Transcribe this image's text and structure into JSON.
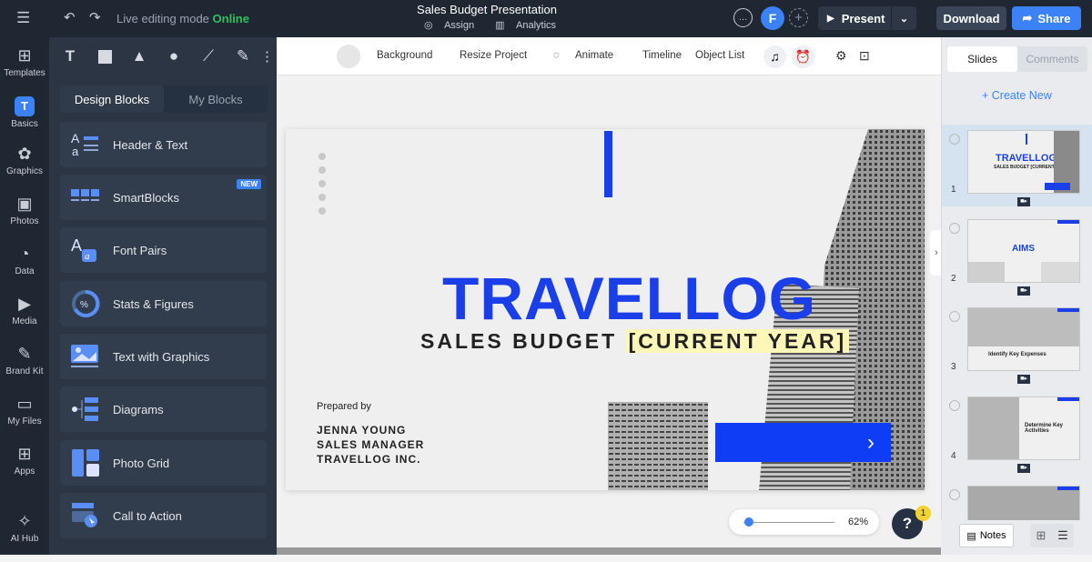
{
  "topbar": {
    "mode_label": "Live editing mode",
    "mode_status": "Online",
    "title": "Sales Budget Presentation",
    "assign_label": "Assign",
    "analytics_label": "Analytics",
    "avatar_letter": "F",
    "present_label": "Present",
    "download_label": "Download",
    "share_label": "Share"
  },
  "rail": {
    "items": [
      {
        "label": "Templates",
        "icon": "templates-icon"
      },
      {
        "label": "Basics",
        "icon": "basics-icon"
      },
      {
        "label": "Graphics",
        "icon": "graphics-icon"
      },
      {
        "label": "Photos",
        "icon": "photos-icon"
      },
      {
        "label": "Data",
        "icon": "data-icon"
      },
      {
        "label": "Media",
        "icon": "media-icon"
      },
      {
        "label": "Brand Kit",
        "icon": "brand-kit-icon"
      },
      {
        "label": "My Files",
        "icon": "folder-icon"
      },
      {
        "label": "Apps",
        "icon": "apps-icon"
      },
      {
        "label": "AI Hub",
        "icon": "sparkle-icon"
      }
    ]
  },
  "panel": {
    "tab_design": "Design Blocks",
    "tab_my": "My Blocks",
    "blocks": [
      {
        "label": "Header & Text"
      },
      {
        "label": "SmartBlocks",
        "badge": "NEW"
      },
      {
        "label": "Font Pairs"
      },
      {
        "label": "Stats & Figures"
      },
      {
        "label": "Text with Graphics"
      },
      {
        "label": "Diagrams"
      },
      {
        "label": "Photo Grid"
      },
      {
        "label": "Call to Action"
      }
    ]
  },
  "canvas_toolbar": {
    "background": "Background",
    "resize": "Resize Project",
    "animate": "Animate",
    "timeline": "Timeline",
    "object_list": "Object List"
  },
  "slide": {
    "title": "TRAVELLOG",
    "subtitle_prefix": "SALES BUDGET ",
    "subtitle_highlight": "[CURRENT YEAR]",
    "prepared_by": "Prepared by",
    "name": "JENNA YOUNG",
    "role": "SALES MANAGER",
    "company": "TRAVELLOG INC.",
    "accent_color": "#1a3fe8"
  },
  "zoom": {
    "value": "62%",
    "fraction": 0.06
  },
  "help": {
    "label": "?",
    "badge": "1"
  },
  "right_panel": {
    "tab_slides": "Slides",
    "tab_comments": "Comments",
    "create_new": "+ Create New",
    "slides": [
      {
        "num": "1",
        "caption": "TRAVELLOG",
        "sub": "SALES BUDGET [CURRENT YEAR]"
      },
      {
        "num": "2",
        "caption": "AIMS"
      },
      {
        "num": "3",
        "caption": "Identify Key Expenses"
      },
      {
        "num": "4",
        "caption": "Determine Key Activities"
      }
    ],
    "notes_label": "Notes"
  }
}
